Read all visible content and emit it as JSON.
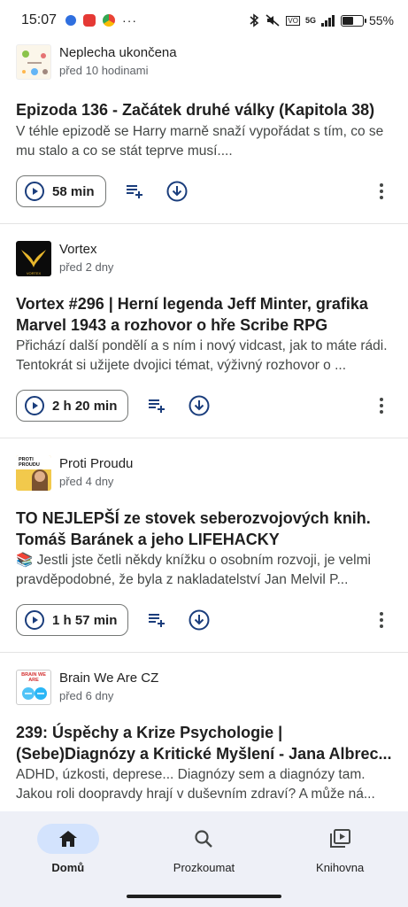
{
  "status_bar": {
    "time": "15:07",
    "dots": "···",
    "network": "5G",
    "battery_percent": "55%",
    "battery_level": 0.55
  },
  "episodes": [
    {
      "show": "Neplecha ukončena",
      "date": "před 10 hodinami",
      "title": "Epizoda 136 - Začátek druhé války (Kapitola 38)",
      "description": "V téhle epizodě se Harry marně snaží vypořádat s tím, co se mu stalo a co se stát teprve musí....",
      "duration": "58 min"
    },
    {
      "show": "Vortex",
      "date": "před 2 dny",
      "title": "Vortex #296 | Herní legenda Jeff Minter, grafika Marvel 1943 a rozhovor o hře Scribe RPG",
      "description": "Přichází další pondělí a s ním i nový vidcast, jak to máte rádi. Tentokrát si užijete dvojici témat, výživný rozhovor o ...",
      "duration": "2 h 20 min",
      "thumb_text": "VORTEX"
    },
    {
      "show": "Proti Proudu",
      "date": "před 4 dny",
      "title": "TO NEJLEPŠÍ ze stovek seberozvojových knih. Tomáš Baránek a jeho LIFEHACKY",
      "description": "📚 Jestli jste četli někdy knížku o osobním rozvoji, je velmi pravděpodobné, že byla z nakladatelství Jan Melvil P...",
      "duration": "1 h 57 min",
      "thumb_text": "PROTI PROUDU"
    },
    {
      "show": "Brain We Are CZ",
      "date": "před 6 dny",
      "title": "239: Úspěchy a Krize Psychologie | (Sebe)Diagnózy a Kritické Myšlení - Jana Albrec...",
      "description": "ADHD, úzkosti, deprese... Diagnózy sem a diagnózy tam. Jakou roli doopravdy hrají v duševním zdraví? A může ná...",
      "thumb_text": "BRAIN WE ARE"
    }
  ],
  "nav": {
    "home": "Domů",
    "explore": "Prozkoumat",
    "library": "Knihovna"
  },
  "colors": {
    "accent": "#1a3d7c",
    "nav_bg": "#eef0f7",
    "active_pill": "#d3e3fd"
  }
}
